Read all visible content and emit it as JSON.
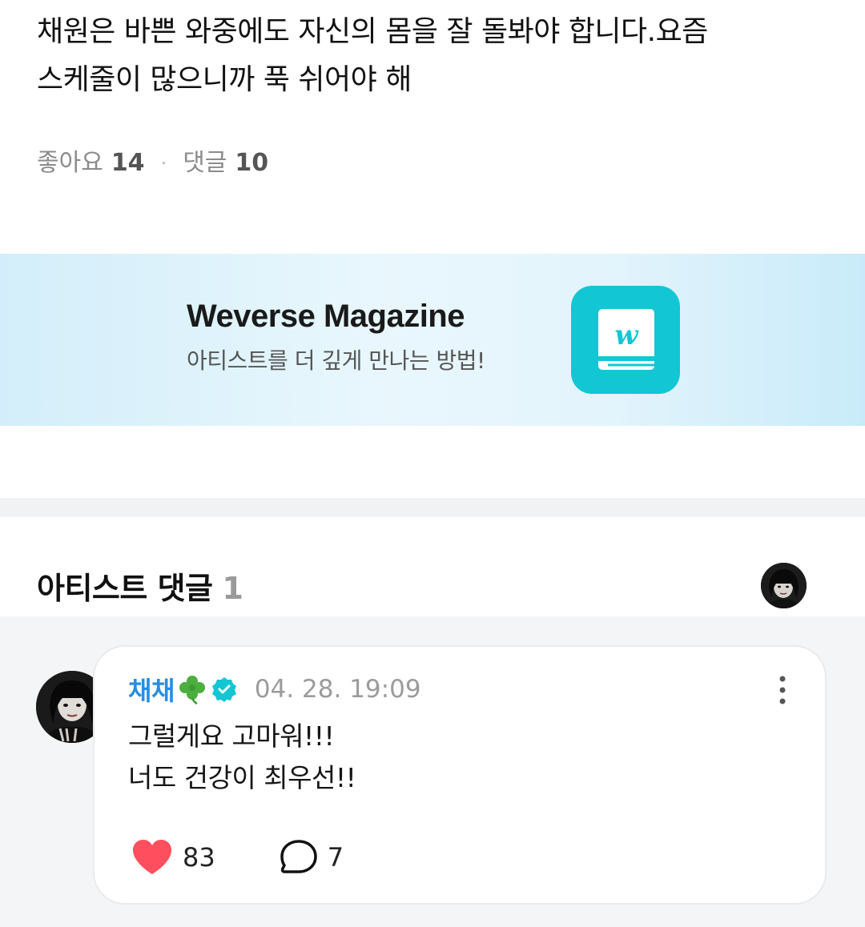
{
  "post": {
    "text_lines": [
      "채원은 바쁜 와중에도 자신의 몸을 잘 돌봐야 합니다.요즘",
      "스케줄이 많으니까 푹 쉬어야 해"
    ],
    "likes_label": "좋아요",
    "likes_count": "14",
    "comments_label": "댓글",
    "comments_count": "10"
  },
  "banner": {
    "title": "Weverse Magazine",
    "subtitle": "아티스트를 더 깊게 만나는 방법!",
    "app_icon": "book-icon",
    "app_color": "#13c6d4"
  },
  "artist_comments": {
    "title": "아티스트 댓글",
    "count": "1"
  },
  "comment": {
    "author": "채채",
    "author_emoji": "clover-icon",
    "verified_icon": "verified-badge-icon",
    "timestamp": "04. 28. 19:09",
    "body_lines": [
      "그럴게요 고마워!!!",
      "너도 건강이 최우선!!"
    ],
    "like_count": "83",
    "reply_count": "7",
    "author_color": "#2a8de0",
    "like_color": "#ff4f5e"
  }
}
